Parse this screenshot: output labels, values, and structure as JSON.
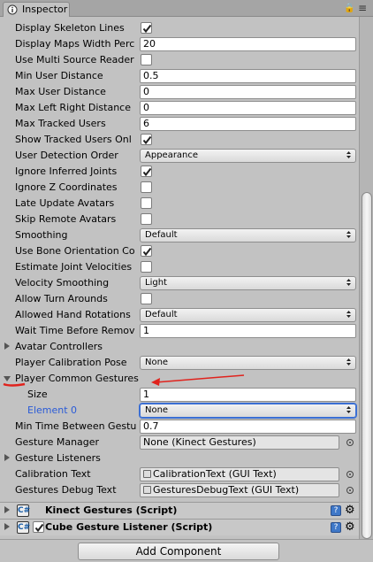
{
  "tab": {
    "title": "Inspector",
    "lock_glyph": "🔒",
    "menu_glyph": "≡"
  },
  "rows": [
    {
      "label": "Display Skeleton Lines",
      "kind": "check",
      "checked": true
    },
    {
      "label": "Display Maps Width Perc",
      "kind": "field",
      "value": "20"
    },
    {
      "label": "Use Multi Source Reader",
      "kind": "check",
      "checked": false
    },
    {
      "label": "Min User Distance",
      "kind": "field",
      "value": "0.5"
    },
    {
      "label": "Max User Distance",
      "kind": "field",
      "value": "0"
    },
    {
      "label": "Max Left Right Distance",
      "kind": "field",
      "value": "0"
    },
    {
      "label": "Max Tracked Users",
      "kind": "field",
      "value": "6"
    },
    {
      "label": "Show Tracked Users Onl",
      "kind": "check",
      "checked": true
    },
    {
      "label": "User Detection Order",
      "kind": "drop",
      "value": "Appearance"
    },
    {
      "label": "Ignore Inferred Joints",
      "kind": "check",
      "checked": true
    },
    {
      "label": "Ignore Z Coordinates",
      "kind": "check",
      "checked": false
    },
    {
      "label": "Late Update Avatars",
      "kind": "check",
      "checked": false
    },
    {
      "label": "Skip Remote Avatars",
      "kind": "check",
      "checked": false
    },
    {
      "label": "Smoothing",
      "kind": "drop",
      "value": "Default"
    },
    {
      "label": "Use Bone Orientation Co",
      "kind": "check",
      "checked": true
    },
    {
      "label": "Estimate Joint Velocities",
      "kind": "check",
      "checked": false
    },
    {
      "label": "Velocity Smoothing",
      "kind": "drop",
      "value": "Light"
    },
    {
      "label": "Allow Turn Arounds",
      "kind": "check",
      "checked": false
    },
    {
      "label": "Allowed Hand Rotations",
      "kind": "drop",
      "value": "Default"
    },
    {
      "label": "Wait Time Before Remov",
      "kind": "field",
      "value": "1"
    },
    {
      "label": "Avatar Controllers",
      "kind": "fold",
      "open": false
    },
    {
      "label": "Player Calibration Pose",
      "kind": "drop",
      "value": "None"
    },
    {
      "label": "Player Common Gestures",
      "kind": "fold",
      "open": true
    },
    {
      "label": "Size",
      "kind": "field",
      "value": "1",
      "indent": true
    },
    {
      "label": "Element 0",
      "kind": "drop",
      "value": "None",
      "indent": true,
      "focused": true
    },
    {
      "label": "Min Time Between Gestu",
      "kind": "field",
      "value": "0.7"
    },
    {
      "label": "Gesture Manager",
      "kind": "obj",
      "value": "None (Kinect Gestures)",
      "icon": false
    },
    {
      "label": "Gesture Listeners",
      "kind": "fold",
      "open": false
    },
    {
      "label": "Calibration Text",
      "kind": "obj",
      "value": "CalibrationText (GUI Text)",
      "icon": true
    },
    {
      "label": "Gestures Debug Text",
      "kind": "obj",
      "value": "GesturesDebugText (GUI Text)",
      "icon": true
    }
  ],
  "components": [
    {
      "title": "Kinect Gestures (Script)",
      "has_checkbox": false
    },
    {
      "title": "Cube Gesture Listener (Script)",
      "has_checkbox": true
    }
  ],
  "add_component": "Add Component",
  "colors": {
    "annotation": "#e0231d",
    "focus": "#3b6fd4",
    "element_label": "#2a5bd7"
  }
}
